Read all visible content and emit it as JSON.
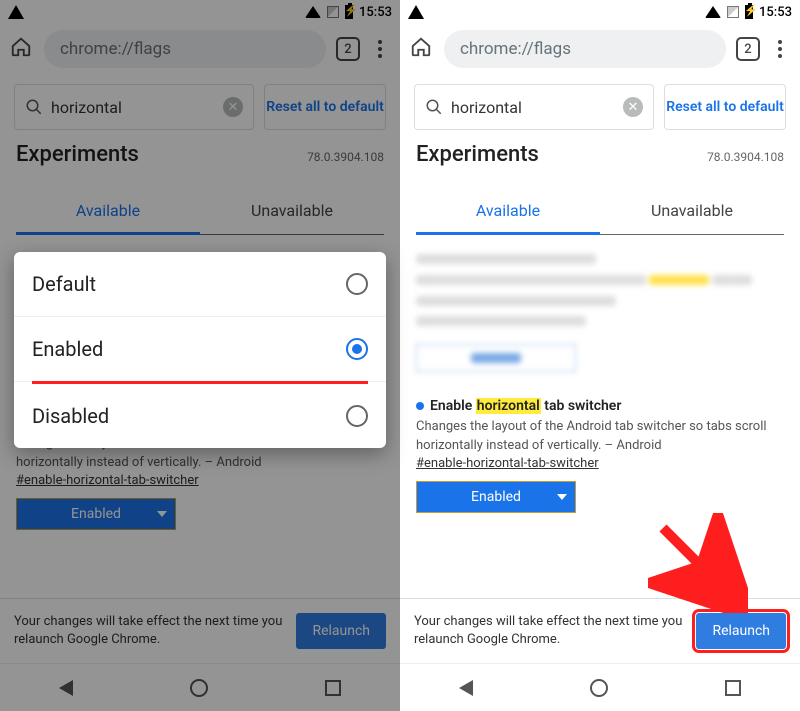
{
  "status": {
    "time": "15:53"
  },
  "omnibox": {
    "url": "chrome://flags",
    "tab_count": "2"
  },
  "search": {
    "value": "horizontal",
    "reset_label": "Reset all to default"
  },
  "header": {
    "title": "Experiments",
    "version": "78.0.3904.108"
  },
  "tabs": {
    "available": "Available",
    "unavailable": "Unavailable"
  },
  "popup": {
    "options": [
      "Default",
      "Enabled",
      "Disabled"
    ],
    "selected": "Enabled"
  },
  "flag": {
    "title_pre": "Enable ",
    "title_hl": "horizontal",
    "title_post": " tab switcher",
    "desc": "Changes the layout of the Android tab switcher so tabs scroll horizontally instead of vertically. – Android",
    "anchor": "#enable-horizontal-tab-switcher",
    "dropdown_value": "Enabled"
  },
  "relaunch": {
    "msg": "Your changes will take effect the next time you relaunch Google Chrome.",
    "btn": "Relaunch"
  }
}
